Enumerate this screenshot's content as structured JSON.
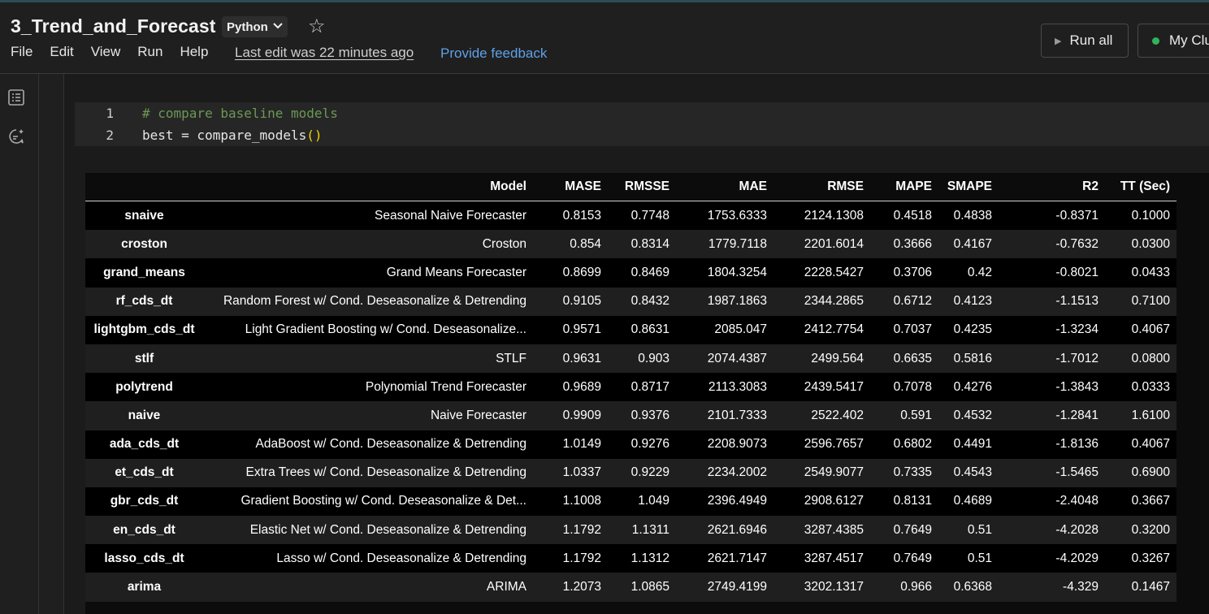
{
  "notebook": {
    "title": "3_Trend_and_Forecast",
    "language": "Python",
    "menu": [
      "File",
      "Edit",
      "View",
      "Run",
      "Help"
    ],
    "last_edit": "Last edit was 22 minutes ago",
    "feedback": "Provide feedback",
    "run_all": "Run all",
    "cluster": "My Clu"
  },
  "cell": {
    "lines": [
      {
        "num": "1",
        "text": "# compare baseline models"
      },
      {
        "num": "2",
        "text_prefix": "best = compare_models",
        "text_paren": "()"
      }
    ]
  },
  "table": {
    "columns": [
      "",
      "Model",
      "MASE",
      "RMSSE",
      "MAE",
      "RMSE",
      "MAPE",
      "SMAPE",
      "R2",
      "TT (Sec)"
    ],
    "rows": [
      [
        "snaive",
        "Seasonal Naive Forecaster",
        "0.8153",
        "0.7748",
        "1753.6333",
        "2124.1308",
        "0.4518",
        "0.4838",
        "-0.8371",
        "0.1000"
      ],
      [
        "croston",
        "Croston",
        "0.854",
        "0.8314",
        "1779.7118",
        "2201.6014",
        "0.3666",
        "0.4167",
        "-0.7632",
        "0.0300"
      ],
      [
        "grand_means",
        "Grand Means Forecaster",
        "0.8699",
        "0.8469",
        "1804.3254",
        "2228.5427",
        "0.3706",
        "0.42",
        "-0.8021",
        "0.0433"
      ],
      [
        "rf_cds_dt",
        "Random Forest w/ Cond. Deseasonalize & Detrending",
        "0.9105",
        "0.8432",
        "1987.1863",
        "2344.2865",
        "0.6712",
        "0.4123",
        "-1.1513",
        "0.7100"
      ],
      [
        "lightgbm_cds_dt",
        "Light Gradient Boosting w/ Cond. Deseasonalize...",
        "0.9571",
        "0.8631",
        "2085.047",
        "2412.7754",
        "0.7037",
        "0.4235",
        "-1.3234",
        "0.4067"
      ],
      [
        "stlf",
        "STLF",
        "0.9631",
        "0.903",
        "2074.4387",
        "2499.564",
        "0.6635",
        "0.5816",
        "-1.7012",
        "0.0800"
      ],
      [
        "polytrend",
        "Polynomial Trend Forecaster",
        "0.9689",
        "0.8717",
        "2113.3083",
        "2439.5417",
        "0.7078",
        "0.4276",
        "-1.3843",
        "0.0333"
      ],
      [
        "naive",
        "Naive Forecaster",
        "0.9909",
        "0.9376",
        "2101.7333",
        "2522.402",
        "0.591",
        "0.4532",
        "-1.2841",
        "1.6100"
      ],
      [
        "ada_cds_dt",
        "AdaBoost w/ Cond. Deseasonalize & Detrending",
        "1.0149",
        "0.9276",
        "2208.9073",
        "2596.7657",
        "0.6802",
        "0.4491",
        "-1.8136",
        "0.4067"
      ],
      [
        "et_cds_dt",
        "Extra Trees w/ Cond. Deseasonalize & Detrending",
        "1.0337",
        "0.9229",
        "2234.2002",
        "2549.9077",
        "0.7335",
        "0.4543",
        "-1.5465",
        "0.6900"
      ],
      [
        "gbr_cds_dt",
        "Gradient Boosting w/ Cond. Deseasonalize & Det...",
        "1.1008",
        "1.049",
        "2396.4949",
        "2908.6127",
        "0.8131",
        "0.4689",
        "-2.4048",
        "0.3667"
      ],
      [
        "en_cds_dt",
        "Elastic Net w/ Cond. Deseasonalize & Detrending",
        "1.1792",
        "1.1311",
        "2621.6946",
        "3287.4385",
        "0.7649",
        "0.51",
        "-4.2028",
        "0.3200"
      ],
      [
        "lasso_cds_dt",
        "Lasso w/ Cond. Deseasonalize & Detrending",
        "1.1792",
        "1.1312",
        "2621.7147",
        "3287.4517",
        "0.7649",
        "0.51",
        "-4.2029",
        "0.3267"
      ],
      [
        "arima",
        "ARIMA",
        "1.2073",
        "1.0865",
        "2749.4199",
        "3202.1317",
        "0.966",
        "0.6368",
        "-4.329",
        "0.1467"
      ]
    ]
  }
}
